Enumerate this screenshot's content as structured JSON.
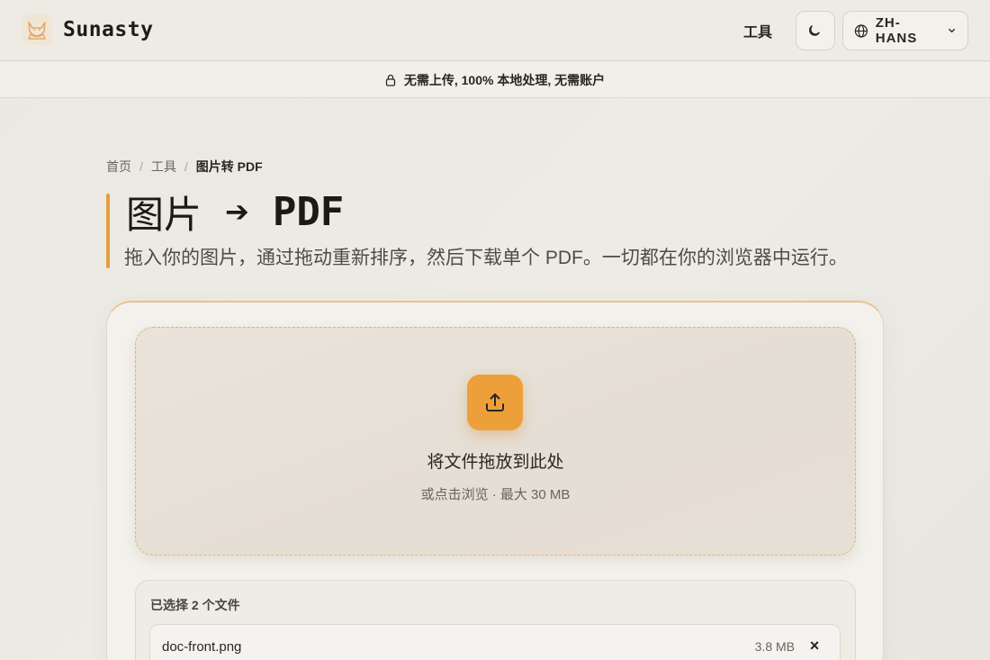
{
  "header": {
    "brand_name": "Sunasty",
    "logo_icon": "fox-logo-icon",
    "nav_tools": "工具",
    "theme_icon": "moon-icon",
    "language": "ZH-HANS",
    "language_icon": "globe-icon",
    "language_chevron": "chevron-down-icon"
  },
  "notice": {
    "icon": "lock-icon",
    "text": "无需上传, 100% 本地处理, 无需账户"
  },
  "breadcrumb": {
    "home": "首页",
    "tools": "工具",
    "current": "图片转 PDF",
    "separator": "/"
  },
  "page": {
    "title_left": "图片",
    "title_arrow": "➔",
    "title_right": "PDF",
    "subtitle": "拖入你的图片，通过拖动重新排序，然后下载单个 PDF。一切都在你的浏览器中运行。"
  },
  "dropzone": {
    "icon": "upload-icon",
    "title": "将文件拖放到此处",
    "hint": "或点击浏览 · 最大 30 MB"
  },
  "files": {
    "heading": "已选择 2 个文件",
    "items": [
      {
        "name": "doc-front.png",
        "size": "3.8 MB",
        "remove": "×"
      }
    ]
  },
  "colors": {
    "accent": "#eda03a",
    "accent_border": "#e3b46a",
    "text": "#2a2622",
    "muted": "#6a645c"
  }
}
